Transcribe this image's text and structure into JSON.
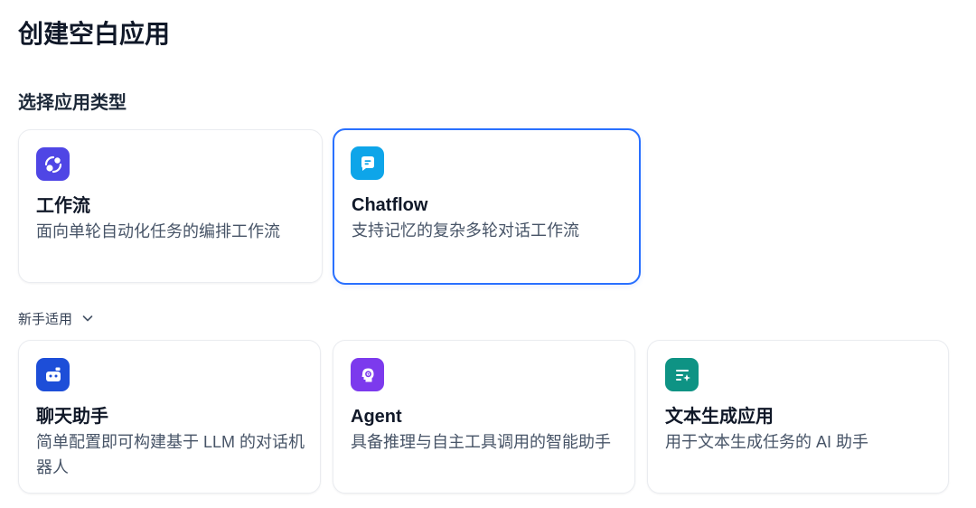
{
  "page": {
    "title": "创建空白应用",
    "section_title": "选择应用类型"
  },
  "app_types": [
    {
      "title": "工作流",
      "description": "面向单轮自动化任务的编排工作流",
      "icon": "workflow-icon",
      "icon_bg": "#4f46e5",
      "selected": false
    },
    {
      "title": "Chatflow",
      "description": "支持记忆的复杂多轮对话工作流",
      "icon": "chatflow-icon",
      "icon_bg": "#0ea5e9",
      "selected": true
    }
  ],
  "beginner": {
    "label": "新手适用",
    "toggle_icon": "chevron-down-icon"
  },
  "beginner_types": [
    {
      "title": "聊天助手",
      "description": "简单配置即可构建基于 LLM 的对话机器人",
      "icon": "chatbot-icon",
      "icon_bg": "#1d4ed8"
    },
    {
      "title": "Agent",
      "description": "具备推理与自主工具调用的智能助手",
      "icon": "agent-icon",
      "icon_bg": "#7c3aed"
    },
    {
      "title": "文本生成应用",
      "description": "用于文本生成任务的 AI 助手",
      "icon": "text-generation-icon",
      "icon_bg": "#0e9384"
    }
  ],
  "colors": {
    "selected_border": "#2970ff",
    "card_border": "#eaecf0"
  }
}
